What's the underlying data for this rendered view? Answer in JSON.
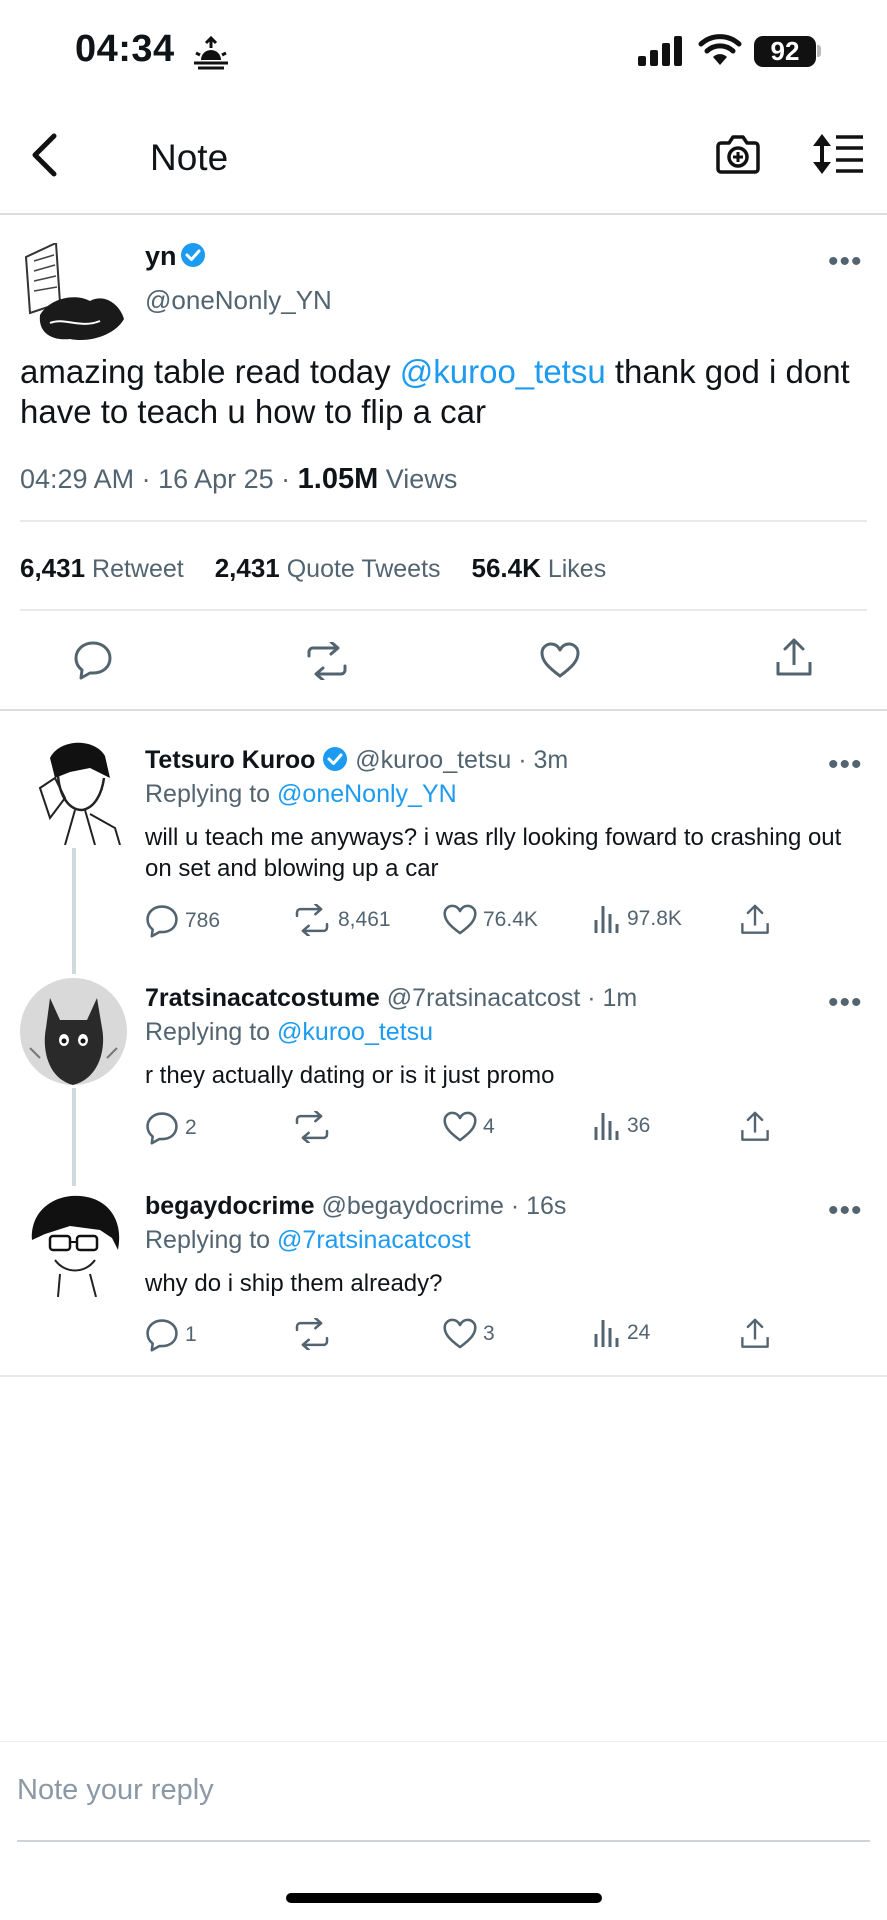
{
  "status_bar": {
    "time": "04:34",
    "battery": "92"
  },
  "nav": {
    "title": "Note"
  },
  "main_tweet": {
    "name": "yn",
    "handle": "@oneNonly_YN",
    "text_before": "amazing table read today ",
    "mention": "@kuroo_tetsu",
    "text_after": " thank god i dont have to teach u how to flip a car",
    "time": "04:29 AM · 16 Apr 25 · ",
    "views_count": "1.05M",
    "views_label": " Views",
    "retweets_count": "6,431",
    "retweets_label": "Retweet",
    "quotes_count": "2,431",
    "quotes_label": "Quote Tweets",
    "likes_count": "56.4K",
    "likes_label": "Likes"
  },
  "replies": [
    {
      "name": "Tetsuro Kuroo",
      "handle": "@kuroo_tetsu · 3m",
      "replying_label": "Replying to ",
      "replying_to": "@oneNonly_YN",
      "text": "will u teach me anyways? i was rlly looking foward to crashing out on set and blowing up a car",
      "replies": "786",
      "retweets": "8,461",
      "likes": "76.4K",
      "views": "97.8K"
    },
    {
      "name": "7ratsinacatcostume",
      "handle": "@7ratsinacatcost · 1m",
      "replying_label": "Replying to ",
      "replying_to": "@kuroo_tetsu",
      "text": "r they actually dating or is it just promo",
      "replies": "2",
      "retweets": "",
      "likes": "4",
      "views": "36"
    },
    {
      "name": "begaydocrime",
      "handle": "@begaydocrime · 16s",
      "replying_label": "Replying to ",
      "replying_to": "@7ratsinacatcost",
      "text": "why do i ship them already?",
      "replies": "1",
      "retweets": "",
      "likes": "3",
      "views": "24"
    }
  ],
  "composer": {
    "placeholder": "Note your reply"
  },
  "colors": {
    "accent": "#1d9bf0",
    "secondary_text": "#536471",
    "divider": "#dcdde0"
  }
}
